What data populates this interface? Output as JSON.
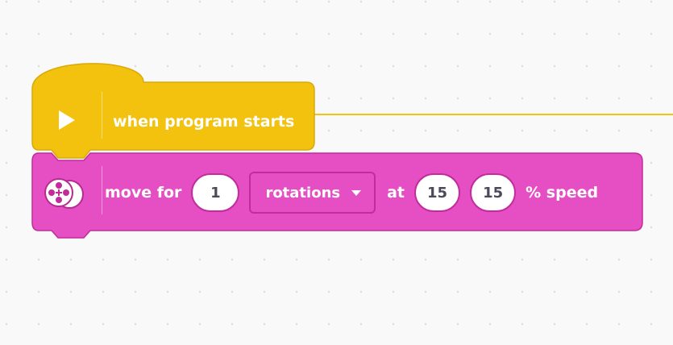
{
  "hat_block": {
    "label": "when program starts",
    "icon": "play-icon",
    "color": "#f2c20f"
  },
  "move_block": {
    "label": "move for",
    "icon": "motor-pair-icon",
    "color": "#e64fc4",
    "amount": "1",
    "unit": "rotations",
    "at_label": "at",
    "speed_left": "15",
    "speed_right": "15",
    "suffix": "% speed"
  }
}
